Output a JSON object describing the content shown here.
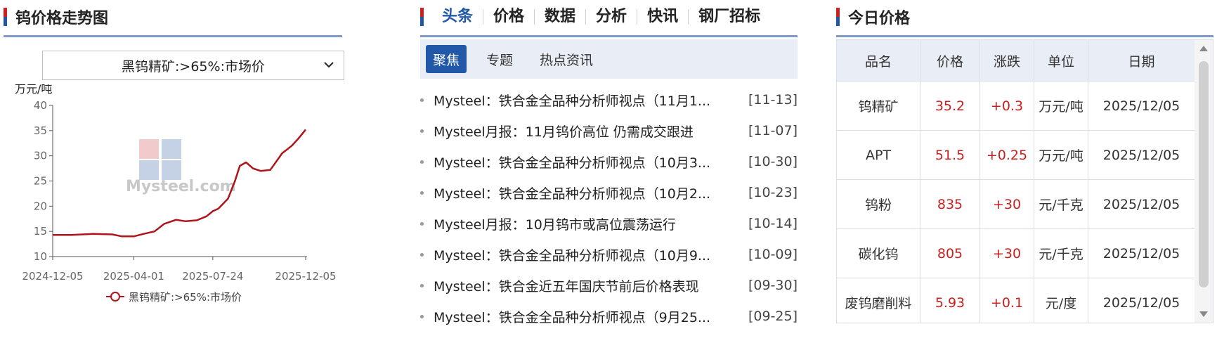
{
  "chart_panel": {
    "title": "钨价格走势图",
    "select_value": "黑钨精矿:>65%:市场价"
  },
  "chart_data": {
    "type": "line",
    "ylabel": "万元/吨",
    "ylim": [
      10,
      40
    ],
    "yticks": [
      "10",
      "15",
      "20",
      "25",
      "30",
      "35",
      "40"
    ],
    "xticks": [
      "2024-12-05",
      "2025-04-01",
      "2025-07-24",
      "2025-12-05"
    ],
    "watermark": "Mysteel.com",
    "series": [
      {
        "name": "黑钨精矿:>65%:市场价",
        "color": "#b0141b",
        "x": [
          "2024-12-05",
          "2025-01-01",
          "2025-02-01",
          "2025-03-01",
          "2025-03-15",
          "2025-04-01",
          "2025-04-15",
          "2025-05-01",
          "2025-05-15",
          "2025-06-01",
          "2025-06-15",
          "2025-07-01",
          "2025-07-15",
          "2025-07-24",
          "2025-08-01",
          "2025-08-15",
          "2025-08-25",
          "2025-09-01",
          "2025-09-10",
          "2025-09-20",
          "2025-10-01",
          "2025-10-15",
          "2025-11-01",
          "2025-11-15",
          "2025-11-25",
          "2025-12-05"
        ],
        "y": [
          14.3,
          14.3,
          14.5,
          14.4,
          14.0,
          14.0,
          14.5,
          15.0,
          16.5,
          17.3,
          17.0,
          17.2,
          18.0,
          19.0,
          19.5,
          21.5,
          25.0,
          28.0,
          28.7,
          27.5,
          27.0,
          27.2,
          30.5,
          32.0,
          33.5,
          35.2
        ]
      }
    ]
  },
  "news_panel": {
    "tabs": [
      "头条",
      "价格",
      "数据",
      "分析",
      "快讯",
      "钢厂招标"
    ],
    "subtabs": [
      "聚焦",
      "专题",
      "热点资讯"
    ],
    "items": [
      {
        "title": "Mysteel：铁合金全品种分析师视点（11月1...",
        "date": "[11-13]"
      },
      {
        "title": "Mysteel月报：11月钨价高位 仍需成交跟进",
        "date": "[11-07]"
      },
      {
        "title": "Mysteel：铁合金全品种分析师视点（10月3...",
        "date": "[10-30]"
      },
      {
        "title": "Mysteel：铁合金全品种分析师视点（10月2...",
        "date": "[10-23]"
      },
      {
        "title": "Mysteel月报：10月钨市或高位震荡运行",
        "date": "[10-14]"
      },
      {
        "title": "Mysteel：铁合金全品种分析师视点（10月9...",
        "date": "[10-09]"
      },
      {
        "title": "Mysteel：铁合金近五年国庆节前后价格表现",
        "date": "[09-30]"
      },
      {
        "title": "Mysteel：铁合金全品种分析师视点（9月25...",
        "date": "[09-25]"
      }
    ]
  },
  "price_panel": {
    "title": "今日价格",
    "headers": [
      "品名",
      "价格",
      "涨跌",
      "单位",
      "日期"
    ],
    "rows": [
      {
        "name": "钨精矿",
        "price": "35.2",
        "change": "+0.3",
        "unit": "万元/吨",
        "date": "2025/12/05"
      },
      {
        "name": "APT",
        "price": "51.5",
        "change": "+0.25",
        "unit": "万元/吨",
        "date": "2025/12/05"
      },
      {
        "name": "钨粉",
        "price": "835",
        "change": "+30",
        "unit": "元/千克",
        "date": "2025/12/05"
      },
      {
        "name": "碳化钨",
        "price": "805",
        "change": "+30",
        "unit": "元/千克",
        "date": "2025/12/05"
      },
      {
        "name": "废钨磨削料",
        "price": "5.93",
        "change": "+0.1",
        "unit": "元/度",
        "date": "2025/12/05"
      }
    ]
  }
}
